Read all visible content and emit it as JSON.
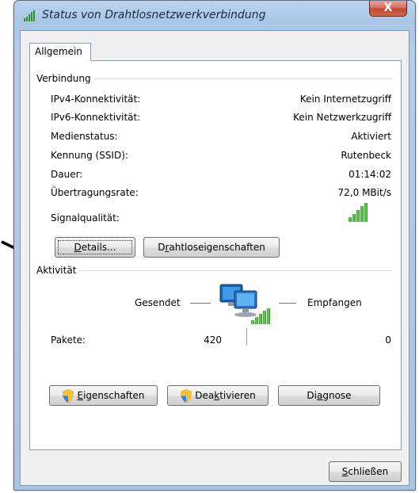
{
  "window": {
    "title": "Status von Drahtlosnetzwerkverbindung",
    "close_glyph": "X"
  },
  "tabs": [
    {
      "label": "Allgemein"
    }
  ],
  "connection": {
    "group_label": "Verbindung",
    "rows": [
      {
        "label": "IPv4-Konnektivität:",
        "value": "Kein Internetzugriff"
      },
      {
        "label": "IPv6-Konnektivität:",
        "value": "Kein Netzwerkzugriff"
      },
      {
        "label": "Medienstatus:",
        "value": "Aktiviert"
      },
      {
        "label": "Kennung (SSID):",
        "value": "Rutenbeck"
      },
      {
        "label": "Dauer:",
        "value": "01:14:02"
      },
      {
        "label": "Übertragungsrate:",
        "value": "72,0 MBit/s"
      }
    ],
    "signal_label": "Signalqualität:",
    "signal_level": 5,
    "signal_max": 5,
    "details_button": {
      "before": "",
      "accel": "D",
      "after": "etails..."
    },
    "wireless_props_button": {
      "before": "D",
      "accel": "r",
      "after": "ahtloseigenschaften"
    }
  },
  "activity": {
    "group_label": "Aktivität",
    "sent_label": "Gesendet",
    "received_label": "Empfangen",
    "packets_label": "Pakete:",
    "packets_sent": "420",
    "packets_received": "0"
  },
  "buttons": {
    "properties": {
      "before": "",
      "accel": "E",
      "after": "igenschaften"
    },
    "deactivate": {
      "before": "Dea",
      "accel": "k",
      "after": "tivieren"
    },
    "diagnose": {
      "before": "Di",
      "accel": "a",
      "after": "gnose"
    },
    "close": {
      "before": "",
      "accel": "S",
      "after": "chließen"
    }
  },
  "colors": {
    "signal_green": "#37a52a",
    "titlebar": "#b4cdea",
    "close_red": "#c04a31"
  },
  "icons": [
    "wireless-signal-icon",
    "network-computers-icon",
    "uac-shield-icon"
  ]
}
